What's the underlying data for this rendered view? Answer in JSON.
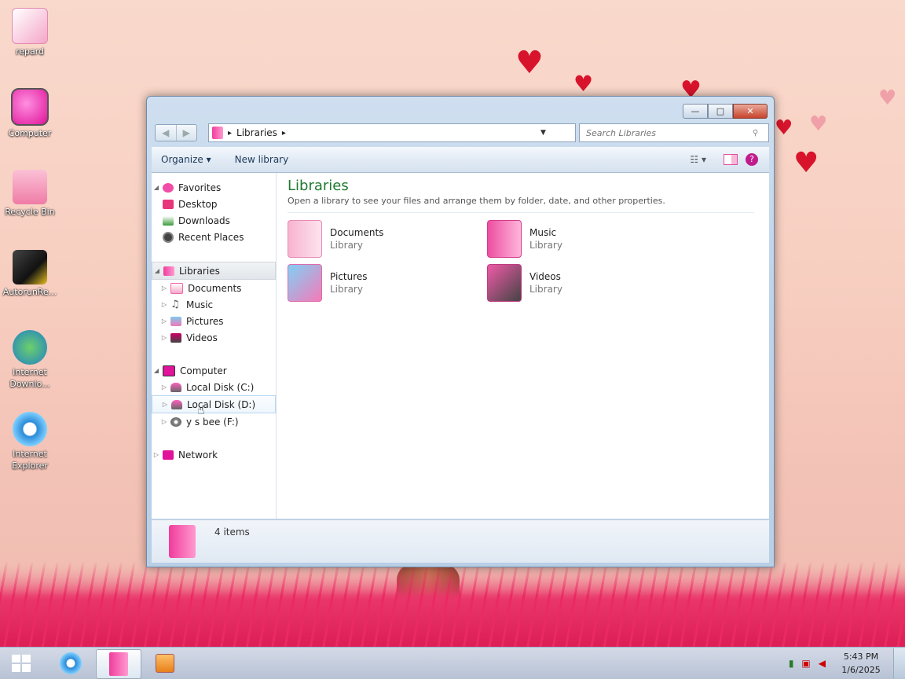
{
  "desktop": {
    "icons": [
      {
        "label": "repard",
        "color": "#f5a6c8"
      },
      {
        "label": "Computer",
        "color": "#ff3fbf"
      },
      {
        "label": "Recycle Bin",
        "color": "#f58bb0"
      },
      {
        "label": "AutorunRe...",
        "color": "#3a3a3a"
      },
      {
        "label": "Internet Downlo...",
        "color": "#2a8a3c"
      },
      {
        "label": "Internet Explorer",
        "color": "#2a8ad8"
      }
    ]
  },
  "window": {
    "caption_buttons": {
      "minimize": "—",
      "maximize": "□",
      "close": "✕"
    },
    "nav": {
      "back": "◀",
      "forward": "▶"
    },
    "address": {
      "crumb": "Libraries",
      "sep": "▸"
    },
    "search": {
      "placeholder": "Search Libraries"
    },
    "toolbar": {
      "organize": "Organize ▾",
      "new_library": "New library",
      "help": "?",
      "views": "☷ ▾"
    },
    "navpane": {
      "favorites": {
        "label": "Favorites",
        "items": [
          "Desktop",
          "Downloads",
          "Recent Places"
        ]
      },
      "libraries": {
        "label": "Libraries",
        "items": [
          "Documents",
          "Music",
          "Pictures",
          "Videos"
        ]
      },
      "computer": {
        "label": "Computer",
        "items": [
          "Local Disk (C:)",
          "Local Disk (D:)",
          "y  s bee (F:)"
        ]
      },
      "network": {
        "label": "Network"
      }
    },
    "main": {
      "title": "Libraries",
      "subtitle": "Open a library to see your files and arrange them by folder, date, and other properties.",
      "libraries": [
        {
          "name": "Documents",
          "type": "Library"
        },
        {
          "name": "Music",
          "type": "Library"
        },
        {
          "name": "Pictures",
          "type": "Library"
        },
        {
          "name": "Videos",
          "type": "Library"
        }
      ]
    },
    "details": {
      "count": "4 items"
    }
  },
  "taskbar": {
    "clock_time": "5:43 PM",
    "clock_date": "1/6/2025"
  },
  "colors": {
    "accent_pink": "#f03c9c",
    "title_green": "#1e7a2e",
    "heart_red": "#d8142c"
  }
}
